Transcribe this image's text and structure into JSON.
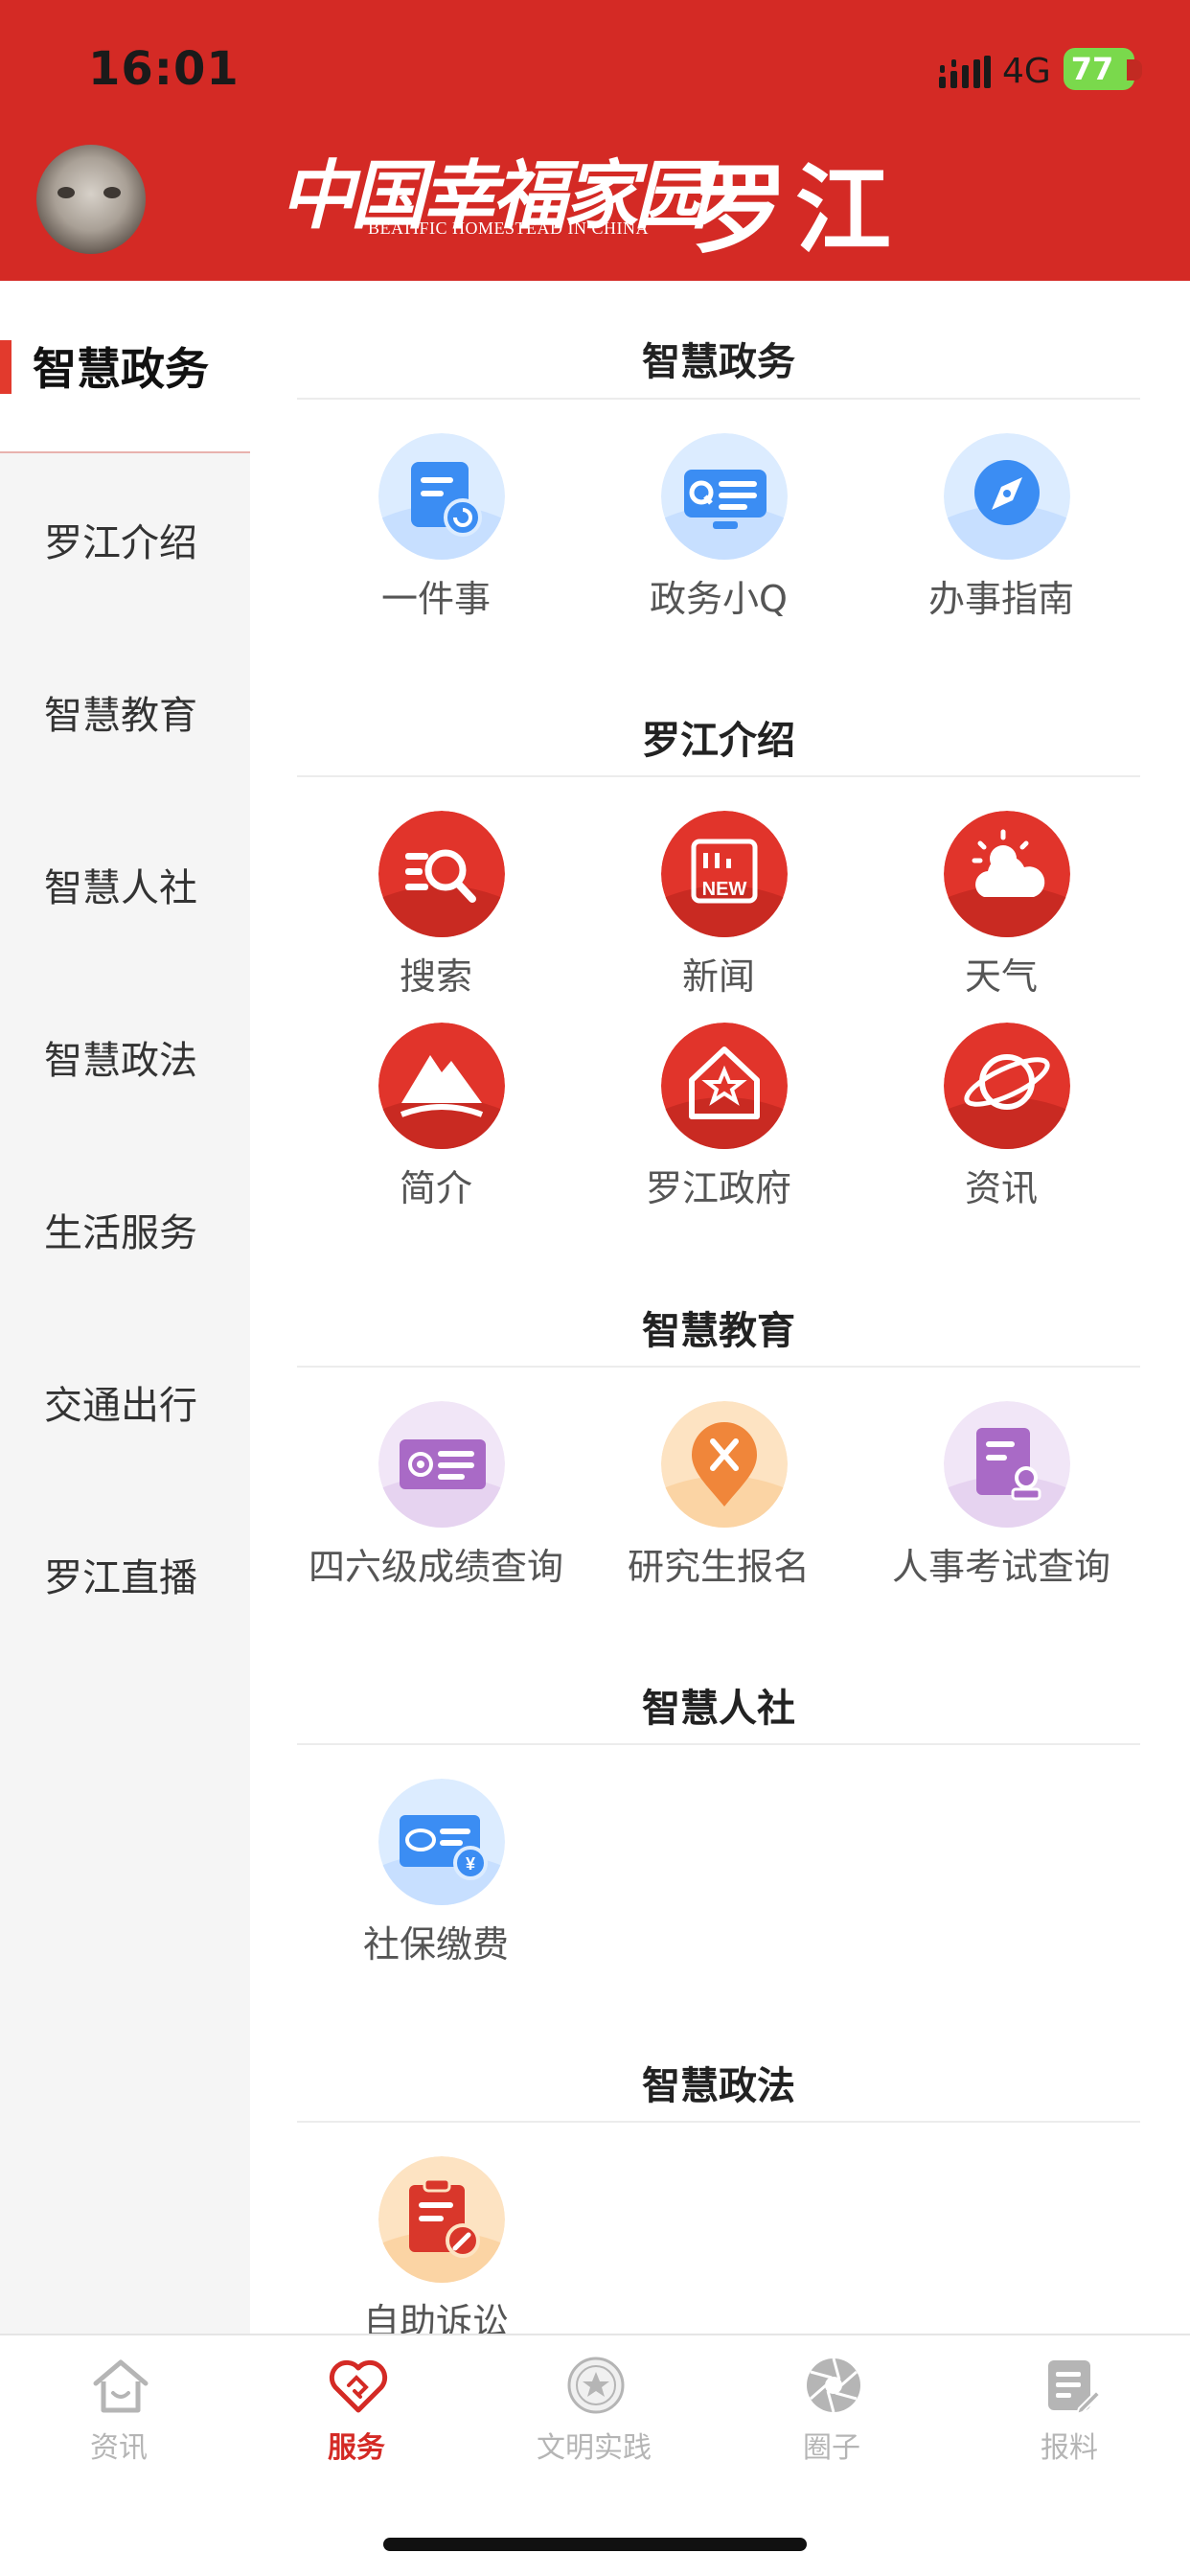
{
  "status_bar": {
    "time": "16:01",
    "network": "4G",
    "battery": "77"
  },
  "header": {
    "logo_text": "中国幸福家园",
    "logo_subtitle": "BEATIFIC HOMESTEAD IN CHINA",
    "city": "罗江",
    "brand_color": "#d42a25"
  },
  "sidebar": {
    "items": [
      {
        "label": "智慧政务"
      },
      {
        "label": "罗江介绍"
      },
      {
        "label": "智慧教育"
      },
      {
        "label": "智慧人社"
      },
      {
        "label": "智慧政法"
      },
      {
        "label": "生活服务"
      },
      {
        "label": "交通出行"
      },
      {
        "label": "罗江直播"
      }
    ],
    "active_index": 0
  },
  "sections": [
    {
      "title": "智慧政务",
      "items": [
        {
          "label": "一件事",
          "icon": "document-refresh-icon"
        },
        {
          "label": "政务小Q",
          "icon": "q-chat-icon"
        },
        {
          "label": "办事指南",
          "icon": "compass-icon"
        }
      ]
    },
    {
      "title": "罗江介绍",
      "items": [
        {
          "label": "搜索",
          "icon": "search-icon"
        },
        {
          "label": "新闻",
          "icon": "news-icon"
        },
        {
          "label": "天气",
          "icon": "weather-icon"
        },
        {
          "label": "简介",
          "icon": "mountain-icon"
        },
        {
          "label": "罗江政府",
          "icon": "government-icon"
        },
        {
          "label": "资讯",
          "icon": "planet-icon"
        }
      ]
    },
    {
      "title": "智慧教育",
      "items": [
        {
          "label": "四六级成绩查询",
          "icon": "score-card-icon"
        },
        {
          "label": "研究生报名",
          "icon": "location-pin-icon"
        },
        {
          "label": "人事考试查询",
          "icon": "exam-document-icon"
        }
      ]
    },
    {
      "title": "智慧人社",
      "items": [
        {
          "label": "社保缴费",
          "icon": "social-security-card-icon"
        }
      ]
    },
    {
      "title": "智慧政法",
      "items": [
        {
          "label": "自助诉讼",
          "icon": "gavel-clipboard-icon"
        }
      ]
    }
  ],
  "tabbar": {
    "items": [
      {
        "label": "资讯",
        "icon": "home-icon"
      },
      {
        "label": "服务",
        "icon": "handshake-heart-icon"
      },
      {
        "label": "文明实践",
        "icon": "emblem-icon"
      },
      {
        "label": "圈子",
        "icon": "aperture-icon"
      },
      {
        "label": "报料",
        "icon": "report-edit-icon"
      }
    ],
    "active_index": 1
  }
}
